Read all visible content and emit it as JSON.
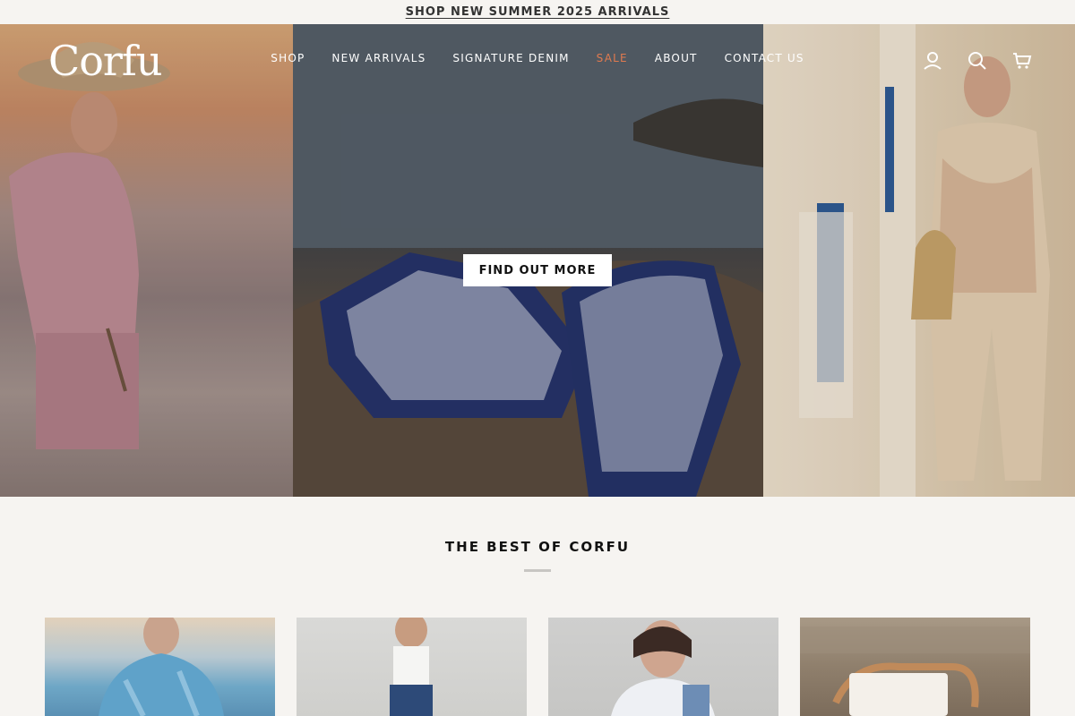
{
  "announcement": {
    "text": "SHOP NEW SUMMER 2025 ARRIVALS"
  },
  "brand": {
    "logo": "Corfu"
  },
  "nav": {
    "items": [
      {
        "label": "SHOP"
      },
      {
        "label": "NEW ARRIVALS"
      },
      {
        "label": "SIGNATURE DENIM"
      },
      {
        "label": "SALE"
      },
      {
        "label": "ABOUT"
      },
      {
        "label": "CONTACT US"
      }
    ]
  },
  "header_icons": [
    "account-icon",
    "search-icon",
    "cart-icon"
  ],
  "hero": {
    "cta_label": "FIND OUT MORE"
  },
  "featured": {
    "title": "THE BEST OF CORFU"
  },
  "colors": {
    "accent_sale": "#e07a4f",
    "background": "#f6f4f1"
  }
}
